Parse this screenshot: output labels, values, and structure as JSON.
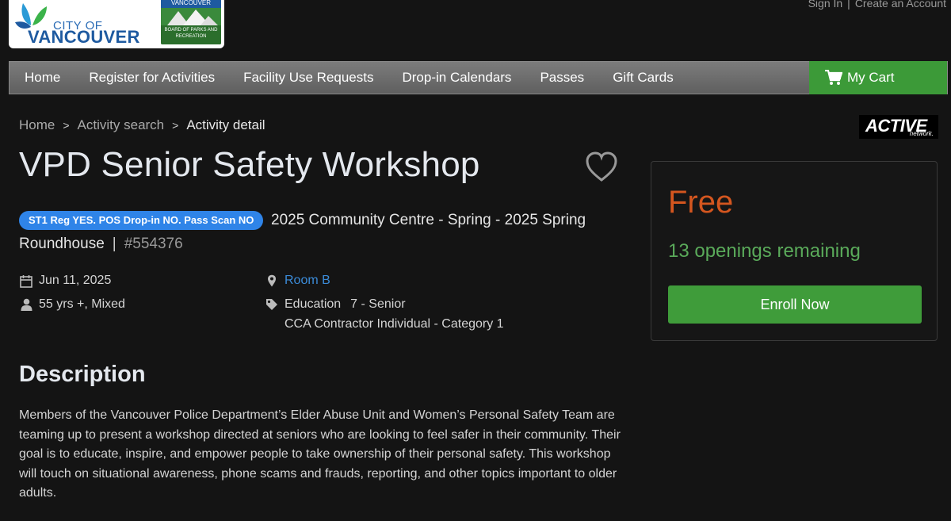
{
  "header": {
    "logo_city_line1": "CITY OF",
    "logo_city_line2": "VANCOUVER",
    "logo_parks_top": "VANCOUVER",
    "logo_parks_bottom": "BOARD OF PARKS AND RECREATION",
    "sign_in": "Sign In",
    "separator": "|",
    "create_account": "Create an Account"
  },
  "nav": {
    "items": [
      "Home",
      "Register for Activities",
      "Facility Use Requests",
      "Drop-in Calendars",
      "Passes",
      "Gift Cards"
    ],
    "cart_label": "My Cart"
  },
  "breadcrumb": {
    "items": [
      "Home",
      "Activity search",
      "Activity detail"
    ],
    "separator": ">"
  },
  "active_logo": {
    "main": "ACTIVE",
    "sub": "network."
  },
  "activity": {
    "title": "VPD Senior Safety Workshop",
    "tag": "ST1 Reg YES. POS Drop-in NO. Pass Scan NO",
    "session": "2025 Community Centre - Spring - 2025 Spring",
    "location": "Roundhouse",
    "pipe": "|",
    "number": "#554376",
    "date": "Jun 11, 2025",
    "age_gender": "55 yrs +, Mixed",
    "room": "Room B",
    "category": "Education",
    "sub_category": "7 - Senior",
    "contractor": "CCA Contractor Individual - Category 1"
  },
  "card": {
    "price": "Free",
    "openings": "13 openings remaining",
    "enroll_label": "Enroll Now"
  },
  "description": {
    "heading": "Description",
    "text": "Members of the Vancouver Police Department’s Elder Abuse Unit and Women’s Personal Safety Team are teaming up to present a workshop directed at seniors who are looking to feel safer in their community. Their goal is to educate, inspire, and empower people to take ownership of their personal safety. This workshop will touch on situational awareness, phone scams and frauds, reporting, and other topics important to older adults."
  },
  "colors": {
    "nav_gradient_top": "#7c7c7c",
    "cart_green": "#3c9a38",
    "tag_blue": "#2f84e8",
    "price_orange": "#d4561f",
    "openings_green": "#5aaa5a",
    "link_blue": "#3b8bd8"
  },
  "icons": [
    "leaf-logo-icon",
    "shopping-cart-icon",
    "heart-icon",
    "calendar-icon",
    "person-icon",
    "map-pin-icon",
    "tag-icon"
  ]
}
